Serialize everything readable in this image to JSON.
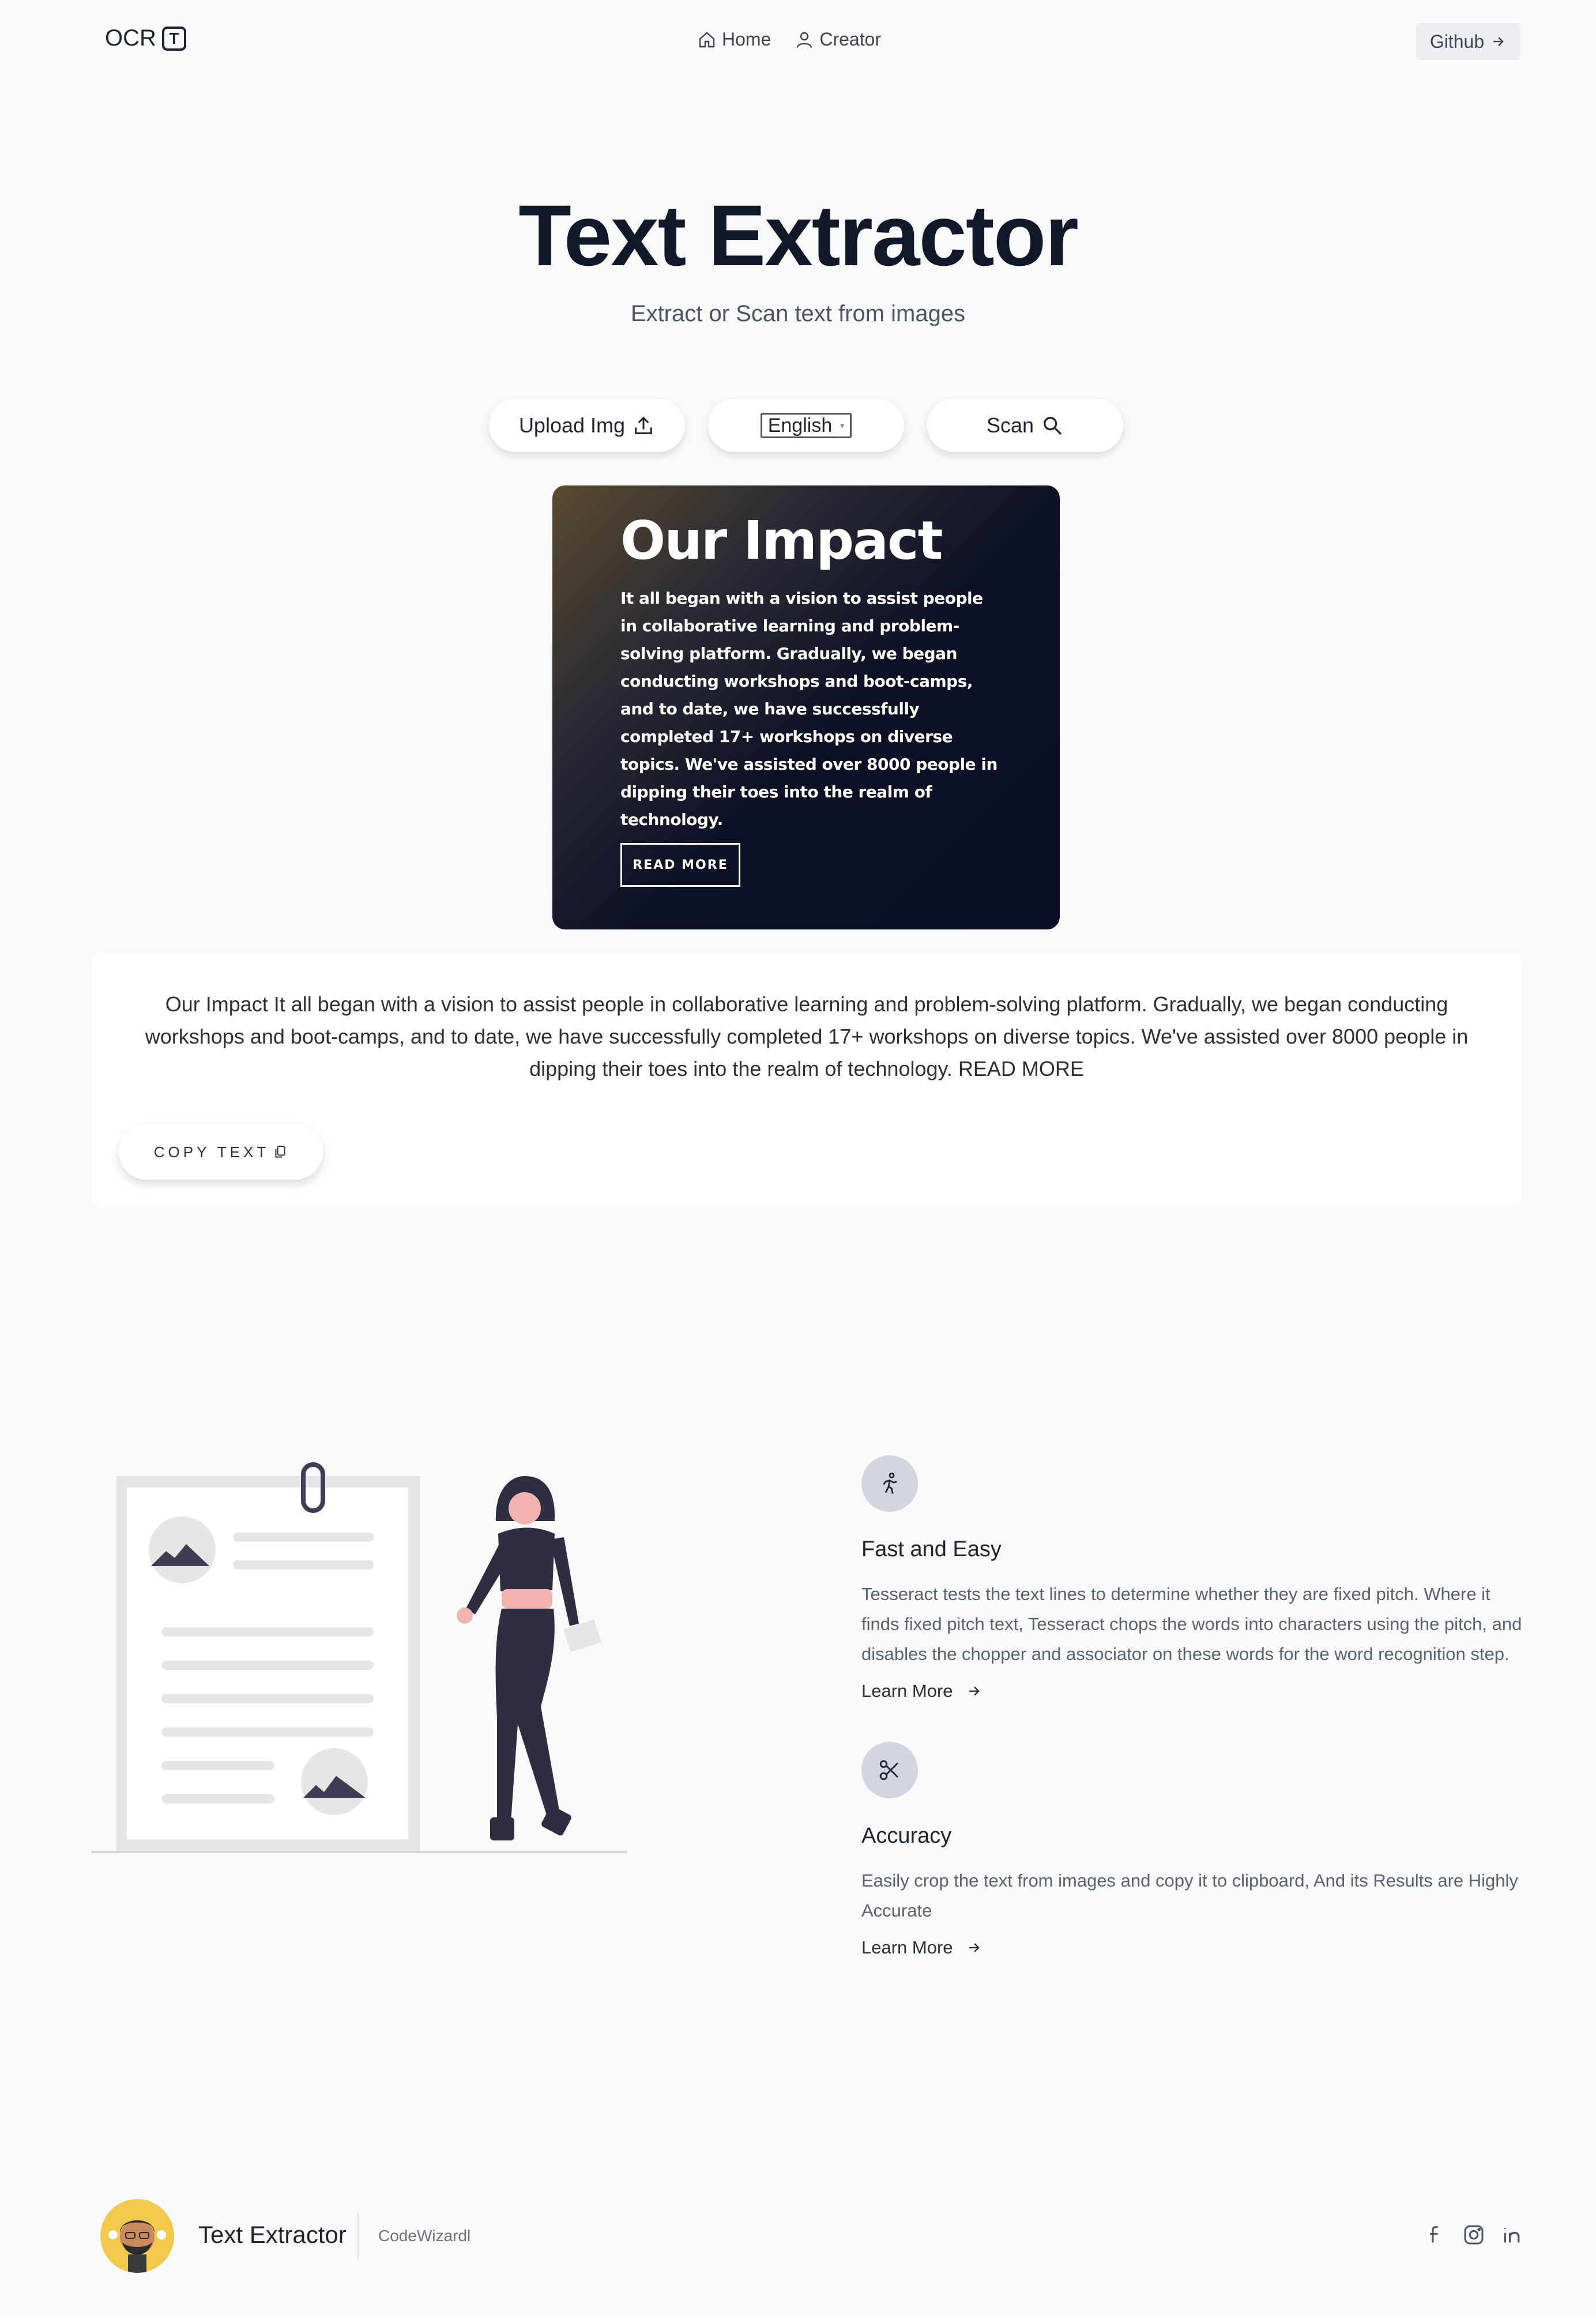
{
  "nav": {
    "logo_text": "OCR",
    "logo_badge": "T",
    "links": [
      {
        "label": "Home",
        "icon": "home-icon"
      },
      {
        "label": "Creator",
        "icon": "user-icon"
      }
    ],
    "github_label": "Github"
  },
  "hero": {
    "title": "Text Extractor",
    "subtitle": "Extract or Scan text from images"
  },
  "actions": {
    "upload_label": "Upload Img",
    "language_selected": "English",
    "scan_label": "Scan"
  },
  "uploaded_image": {
    "heading": "Our Impact",
    "body": "It all began with a vision to assist people in collaborative learning and problem-solving platform. Gradually, we began conducting workshops and boot-camps, and to date, we have successfully completed 17+ workshops on diverse topics. We've assisted over 8000 people in dipping their toes into the realm of technology.",
    "button": "READ MORE"
  },
  "result": {
    "text": "Our Impact It all began with a vision to assist people in collaborative learning and problem-solving platform. Gradually, we began conducting workshops and boot-camps, and to date, we have successfully completed 17+ workshops on diverse topics. We've assisted over 8000 people in dipping their toes into the realm of technology. READ MORE",
    "copy_label": "COPY TEXT"
  },
  "features": [
    {
      "icon": "running-person-icon",
      "title": "Fast and Easy",
      "description": "Tesseract tests the text lines to determine whether they are fixed pitch. Where it finds fixed pitch text, Tesseract chops the words into characters using the pitch, and disables the chopper and associator on these words for the word recognition step.",
      "link": "Learn More"
    },
    {
      "icon": "scissors-icon",
      "title": "Accuracy",
      "description": "Easily crop the text from images and copy it to clipboard, And its Results are Highly Accurate",
      "link": "Learn More"
    }
  ],
  "footer": {
    "name": "Text Extractor",
    "credit": "CodeWizardl",
    "socials": [
      "facebook-icon",
      "instagram-icon",
      "linkedin-icon"
    ]
  },
  "colors": {
    "background": "#f8f9fb",
    "text": "#1f2430",
    "card_dark": "#0a0e25",
    "icon_circle": "#d1d6df",
    "avatar_bg": "#f2c94c"
  }
}
